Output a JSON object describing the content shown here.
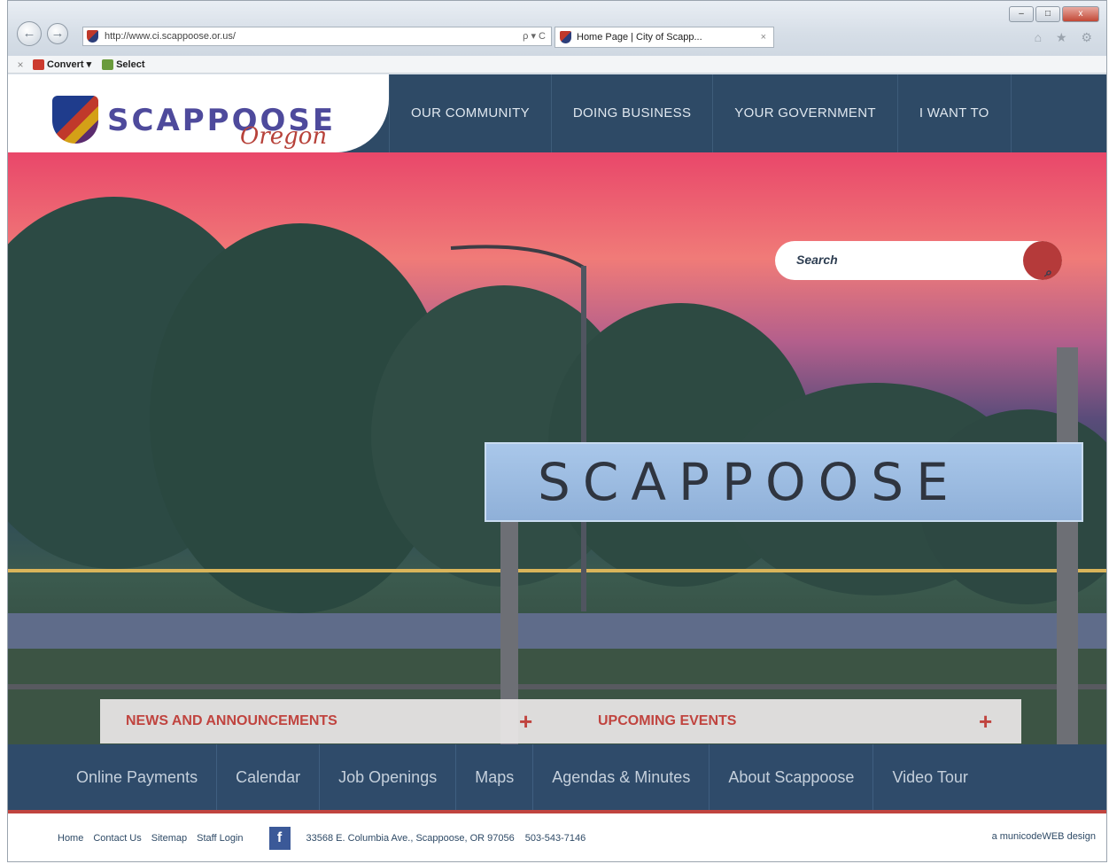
{
  "browser": {
    "url": "http://www.ci.scappoose.or.us/",
    "tab_title": "Home Page | City of Scapp...",
    "tab_close": "×",
    "search_refresh": "ρ ▾ C",
    "back": "←",
    "forward": "→",
    "right_icons": "⌂ ★ ⚙",
    "window_controls": {
      "minimize": "–",
      "maximize": "□",
      "close": "x"
    },
    "command_bar": {
      "close": "×",
      "convert": "Convert",
      "convert_arrow": "▾",
      "select": "Select"
    }
  },
  "site": {
    "logo_text": "SCAPPOOSE",
    "logo_sub": "Oregon",
    "main_nav": [
      "OUR COMMUNITY",
      "DOING BUSINESS",
      "YOUR GOVERNMENT",
      "I WANT TO"
    ],
    "search_placeholder": "Search",
    "search_icon": "search-icon",
    "sign_text": "SCAPPOOSE",
    "panels": {
      "news": "NEWS AND ANNOUNCEMENTS",
      "events": "UPCOMING EVENTS",
      "plus": "+"
    },
    "quick_links": [
      "Online Payments",
      "Calendar",
      "Job Openings",
      "Maps",
      "Agendas & Minutes",
      "About Scappoose",
      "Video Tour"
    ],
    "footer": {
      "links": [
        "Home",
        "Contact Us",
        "Sitemap",
        "Staff Login"
      ],
      "facebook": "f",
      "address": "33568 E. Columbia Ave., Scappoose, OR 97056",
      "phone": "503-543-7146",
      "credit": "a municodeWEB design"
    }
  },
  "colors": {
    "navy": "#2e4a66",
    "accent_red": "#c0443f",
    "logo_purple": "#4e4a9c"
  }
}
